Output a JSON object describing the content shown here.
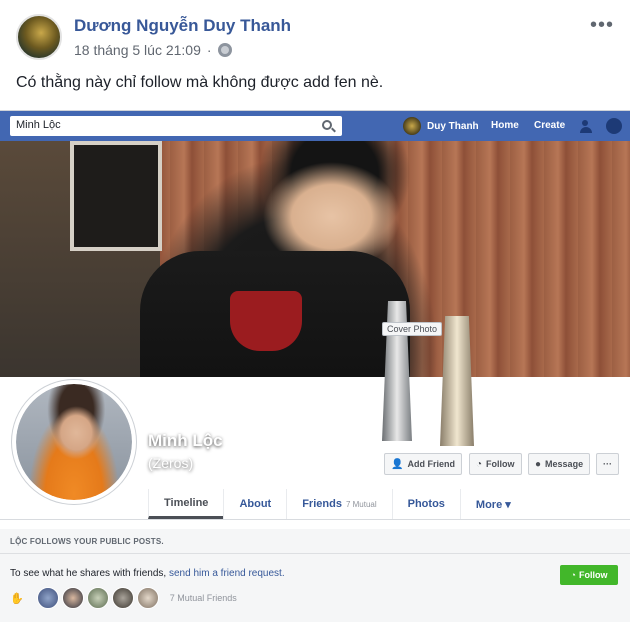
{
  "post": {
    "author": "Dương Nguyễn Duy Thanh",
    "timestamp": "18 tháng 5 lúc 21:09",
    "separator": "·",
    "more": "•••",
    "text": "Có thằng này chỉ follow mà không được add fen nè."
  },
  "screenshot": {
    "topbar": {
      "search_value": "Minh Lộc",
      "user_name": "Duy Thanh",
      "home": "Home",
      "create": "Create"
    },
    "cover_tooltip": "Cover Photo",
    "profile": {
      "name": "Minh Lộc",
      "nickname": "(Zeros)"
    },
    "buttons": {
      "add_friend": "Add Friend",
      "follow": "Follow",
      "message": "Message",
      "more": "···"
    },
    "tabs": [
      {
        "label": "Timeline"
      },
      {
        "label": "About"
      },
      {
        "label": "Friends",
        "count": "7 Mutual"
      },
      {
        "label": "Photos"
      },
      {
        "label": "More ▾"
      }
    ],
    "follow_section": {
      "heading": "LỘC FOLLOWS YOUR PUBLIC POSTS.",
      "text": "To see what he shares with friends,",
      "link": "send him a friend request.",
      "follow_button": "Follow",
      "mutual": "7 Mutual Friends"
    },
    "colors": {
      "fb_blue": "#4267b2",
      "link": "#365899",
      "follow_green": "#42b72a"
    }
  }
}
